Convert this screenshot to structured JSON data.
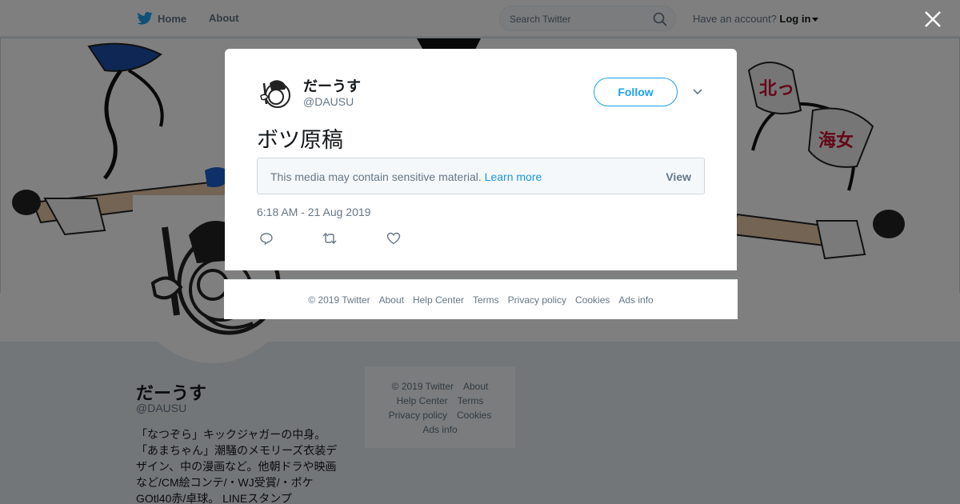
{
  "nav": {
    "home_label": "Home",
    "about_label": "About",
    "search_placeholder": "Search Twitter",
    "account_prompt": "Have an account?",
    "login_label": "Log in"
  },
  "profile": {
    "name": "だーうす",
    "handle": "@DAUSU",
    "bio": "「なつぞら」キックジャガーの中身。\n「あまちゃん」潮騒のメモリーズ衣装デザイン、中の漫画など。他朝ドラや映画など/CM絵コンテ/・WJ受賞/・ポケGOtl40赤/卓球。 LINEスタンプ"
  },
  "side_footer": {
    "copyright": "© 2019 Twitter",
    "about": "About",
    "help": "Help Center",
    "terms": "Terms",
    "privacy": "Privacy policy",
    "cookies": "Cookies",
    "ads": "Ads info"
  },
  "tweet": {
    "name": "だーうす",
    "handle": "@DAUSU",
    "follow_label": "Follow",
    "text": "ボツ原稿",
    "sensitive_message": "This media may contain sensitive material.",
    "learn_more": "Learn more",
    "view_label": "View",
    "timestamp": "6:18 AM - 21 Aug 2019"
  },
  "modal_footer": {
    "copyright": "© 2019 Twitter",
    "about": "About",
    "help": "Help Center",
    "terms": "Terms",
    "privacy": "Privacy policy",
    "cookies": "Cookies",
    "ads": "Ads info"
  },
  "colors": {
    "accent": "#1da1f2",
    "link": "#1b95e0",
    "muted": "#657786",
    "banner_red": "#c8102e"
  },
  "icons": [
    "twitter-bird-icon",
    "search-icon",
    "close-icon",
    "chevron-down-icon",
    "reply-icon",
    "retweet-icon",
    "like-icon"
  ]
}
